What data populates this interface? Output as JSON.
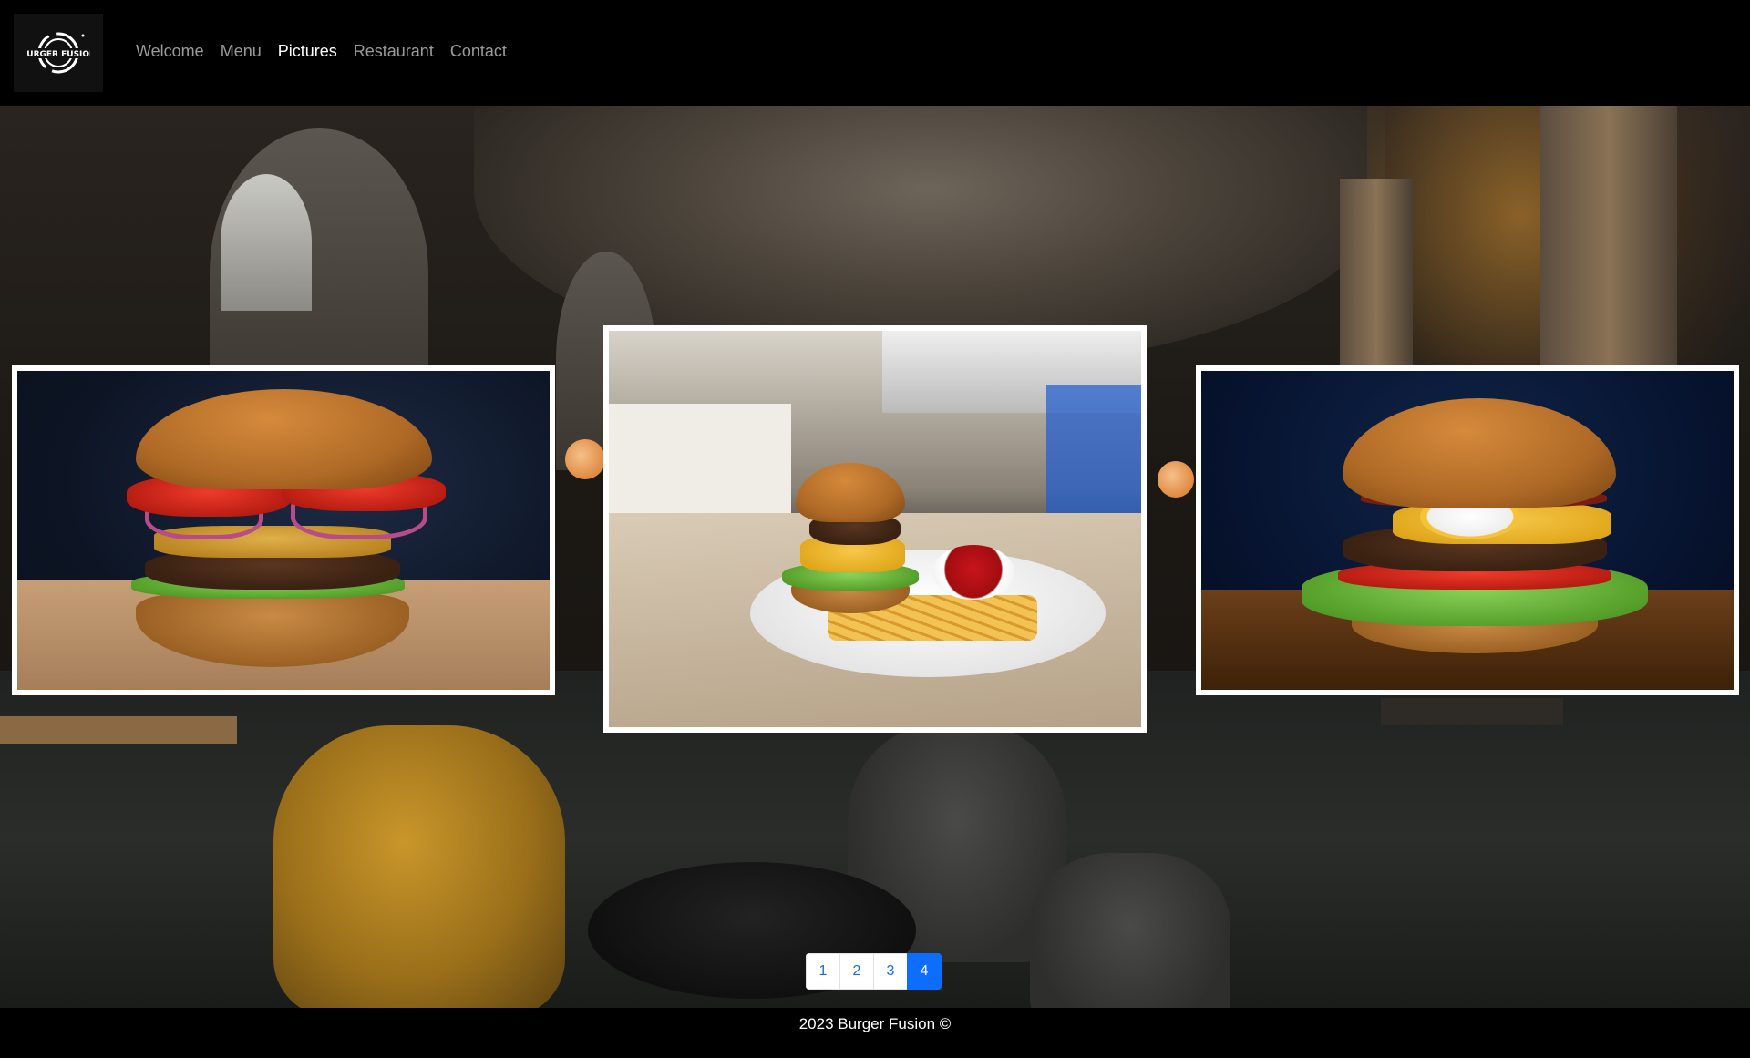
{
  "brand": {
    "logo_text": "BURGER FUSION",
    "logo_icon": "burger-fusion-logo"
  },
  "nav": {
    "items": [
      {
        "label": "Welcome",
        "active": false
      },
      {
        "label": "Menu",
        "active": false
      },
      {
        "label": "Pictures",
        "active": true
      },
      {
        "label": "Restaurant",
        "active": false
      },
      {
        "label": "Contact",
        "active": false
      }
    ]
  },
  "gallery": {
    "images": [
      {
        "name": "burger-with-pineapple-photo"
      },
      {
        "name": "burger-with-fries-photo"
      },
      {
        "name": "burger-with-egg-bacon-photo"
      }
    ]
  },
  "pagination": {
    "pages": [
      "1",
      "2",
      "3",
      "4"
    ],
    "active_page": "4",
    "active_color": "#0d6efd"
  },
  "footer": {
    "text": "2023 Burger Fusion ©"
  }
}
